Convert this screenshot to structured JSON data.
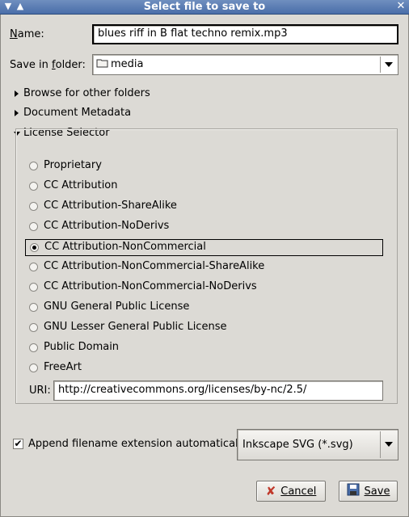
{
  "window": {
    "title": "Select file to save to"
  },
  "name_field": {
    "label": "Name:",
    "value": "blues riff in B flat techno remix.mp3"
  },
  "save_in": {
    "label": "Save in folder:",
    "value": "media",
    "icon": "folder-icon"
  },
  "expanders": {
    "browse": "Browse for other folders",
    "metadata": "Document Metadata",
    "license": "License Selector"
  },
  "licenses": [
    {
      "label": "Proprietary",
      "selected": false
    },
    {
      "label": "CC Attribution",
      "selected": false
    },
    {
      "label": "CC Attribution-ShareAlike",
      "selected": false
    },
    {
      "label": "CC Attribution-NoDerivs",
      "selected": false
    },
    {
      "label": "CC Attribution-NonCommercial",
      "selected": true
    },
    {
      "label": "CC Attribution-NonCommercial-ShareAlike",
      "selected": false
    },
    {
      "label": "CC Attribution-NonCommercial-NoDerivs",
      "selected": false
    },
    {
      "label": "GNU General Public License",
      "selected": false
    },
    {
      "label": "GNU Lesser General Public License",
      "selected": false
    },
    {
      "label": "Public Domain",
      "selected": false
    },
    {
      "label": "FreeArt",
      "selected": false
    }
  ],
  "uri": {
    "label": "URI:",
    "value": "http://creativecommons.org/licenses/by-nc/2.5/"
  },
  "append_extension": {
    "label": "Append filename extension automatically",
    "checked": true
  },
  "file_type": {
    "value": "Inkscape SVG (*.svg)"
  },
  "buttons": {
    "cancel": "Cancel",
    "save": "Save"
  },
  "colors": {
    "titlebar": "#4a6ea9",
    "background": "#dcdad5"
  }
}
